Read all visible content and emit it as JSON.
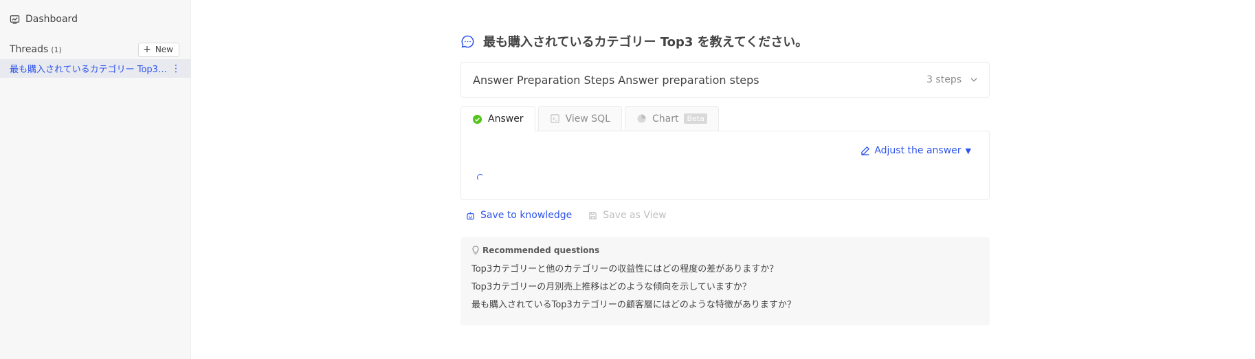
{
  "sidebar": {
    "dashboard_label": "Dashboard",
    "threads_title": "Threads",
    "threads_count": "(1)",
    "new_button": "New",
    "thread_items": [
      {
        "label": "最も購入されているカテゴリー Top3 ..."
      }
    ]
  },
  "main": {
    "question": "最も購入されているカテゴリー Top3 を教えてください。",
    "steps": {
      "image_alt": "Answer Preparation Steps",
      "label": "Answer preparation steps",
      "count": "3 steps"
    },
    "tabs": [
      {
        "label": "Answer"
      },
      {
        "label": "View SQL"
      },
      {
        "label": "Chart",
        "badge": "Beta"
      }
    ],
    "adjust_label": "Adjust the answer",
    "actions": {
      "save_knowledge": "Save to knowledge",
      "save_view": "Save as View"
    },
    "recommended": {
      "title": "Recommended questions",
      "items": [
        "Top3カテゴリーと他のカテゴリーの収益性にはどの程度の差がありますか？",
        "Top3カテゴリーの月別売上推移はどのような傾向を示していますか？",
        "最も購入されているTop3カテゴリーの顧客層にはどのような特徴がありますか？"
      ]
    }
  },
  "colors": {
    "accent": "#2f54eb",
    "success": "#52c41a",
    "sidebar_bg": "#f7f7f7",
    "selected_bg": "#e8eaf0"
  }
}
